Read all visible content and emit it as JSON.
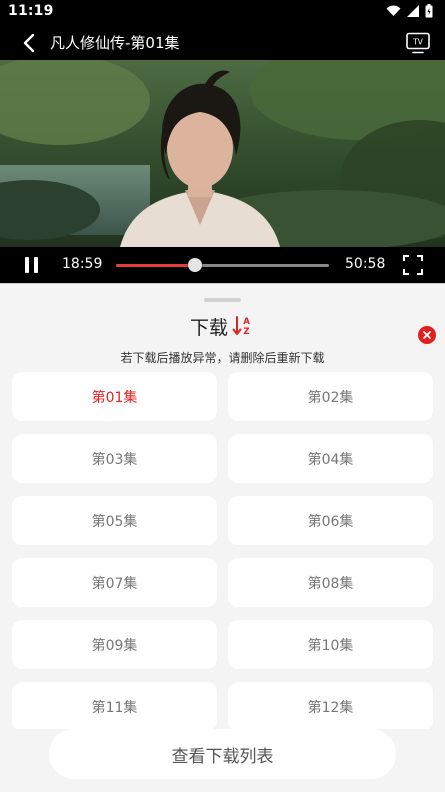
{
  "status_bar": {
    "time": "11:19",
    "icons": [
      "wifi-icon",
      "signal-icon",
      "battery-icon"
    ]
  },
  "player": {
    "title": "凡人修仙传-第01集",
    "back_icon": "chevron-left-icon",
    "cast_icon": "tv-icon",
    "current_time": "18:59",
    "total_time": "50:58",
    "progress": 0.37,
    "accent_color": "#e23c3c"
  },
  "sheet": {
    "title": "下载",
    "sort_icon": "sort-az-icon",
    "close_icon": "close-icon",
    "hint": "若下载后播放异常，请删除后重新下载",
    "episodes": [
      {
        "label": "第01集",
        "selected": true
      },
      {
        "label": "第02集",
        "selected": false
      },
      {
        "label": "第03集",
        "selected": false
      },
      {
        "label": "第04集",
        "selected": false
      },
      {
        "label": "第05集",
        "selected": false
      },
      {
        "label": "第06集",
        "selected": false
      },
      {
        "label": "第07集",
        "selected": false
      },
      {
        "label": "第08集",
        "selected": false
      },
      {
        "label": "第09集",
        "selected": false
      },
      {
        "label": "第10集",
        "selected": false
      },
      {
        "label": "第11集",
        "selected": false
      },
      {
        "label": "第12集",
        "selected": false
      }
    ],
    "view_list_label": "查看下载列表",
    "selected_color": "#e02323"
  }
}
